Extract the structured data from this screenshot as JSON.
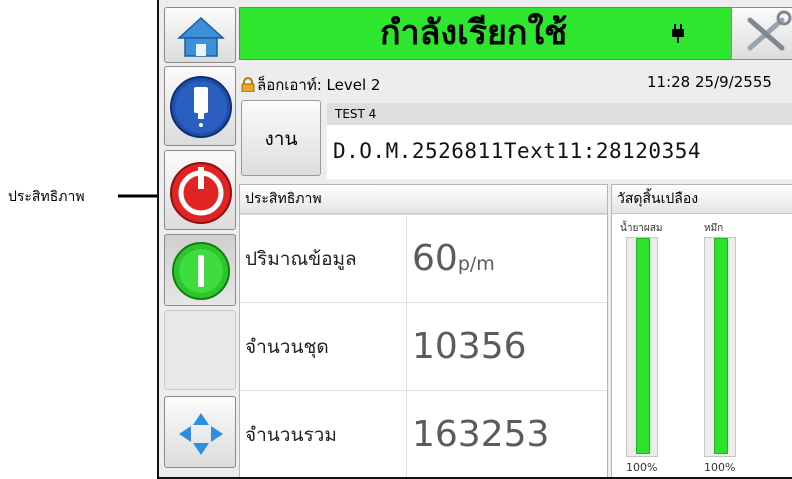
{
  "callout": {
    "label": "ประสิทธิภาพ"
  },
  "header": {
    "status_text": "กำลังเรียกใช้",
    "status_color": "#2ee62e",
    "plug_icon": "plug-icon",
    "tools_icon": "tools-icon"
  },
  "sidebar": {
    "home_icon": "home-icon",
    "info_icon": "printer-info-icon",
    "stop_icon": "power-stop-icon",
    "start_icon": "power-start-icon",
    "nav_icon": "navigation-arrows-icon"
  },
  "login": {
    "icon": "lock-icon",
    "text": "ล็อกเอาท์: Level 2",
    "datetime": "11:28 25/9/2555"
  },
  "job": {
    "button_label": "งาน",
    "name": "TEST 4",
    "message": "D.O.M.2526811Text11:28120354"
  },
  "performance": {
    "title": "ประสิทธิภาพ",
    "rows": [
      {
        "label": "ปริมาณข้อมูล",
        "value": "60",
        "unit": "p/m"
      },
      {
        "label": "จำนวนชุด",
        "value": "10356",
        "unit": ""
      },
      {
        "label": "จำนวนรวม",
        "value": "163253",
        "unit": ""
      }
    ]
  },
  "consumables": {
    "title": "วัสดุสิ้นเปลือง",
    "fill_color": "#2de22d",
    "items": [
      {
        "label": "น้ำยาผสม",
        "level": 1.0,
        "percent_label": "100%"
      },
      {
        "label": "หมึก",
        "level": 1.0,
        "percent_label": "100%"
      }
    ]
  }
}
